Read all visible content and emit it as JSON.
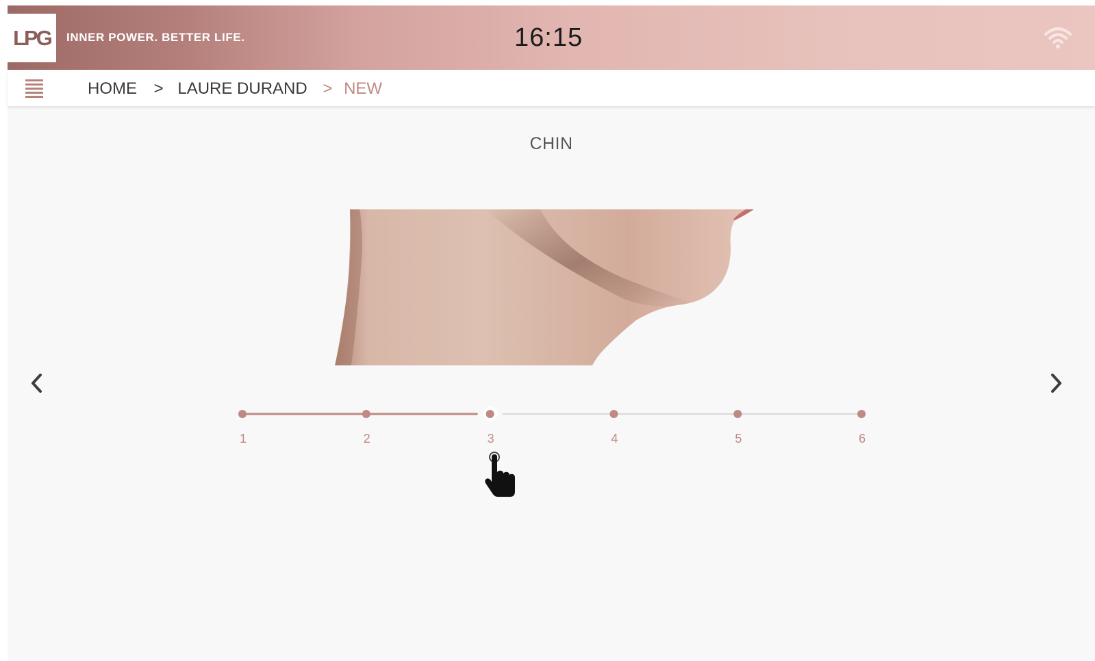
{
  "header": {
    "logo_text": "LPG",
    "tagline": "INNER POWER. BETTER LIFE.",
    "time": "16:15",
    "wifi_icon": "wifi-icon"
  },
  "navbar": {
    "menu_icon": "hamburger-menu-icon",
    "breadcrumb": {
      "home": "HOME",
      "separator": ">",
      "client": "LAURE DURAND",
      "current": "NEW"
    }
  },
  "main": {
    "zone_title": "CHIN",
    "image_icon": "chin-photo",
    "prev_icon": "chevron-left-icon",
    "next_icon": "chevron-right-icon",
    "slider": {
      "steps": [
        "1",
        "2",
        "3",
        "4",
        "5",
        "6"
      ],
      "selected": "3"
    }
  },
  "colors": {
    "accent": "#bf8a84",
    "header_dark": "#9c6a66",
    "header_light": "#ebc5bf",
    "track_inactive": "#d9d9d9",
    "background": "#f8f8f8"
  }
}
